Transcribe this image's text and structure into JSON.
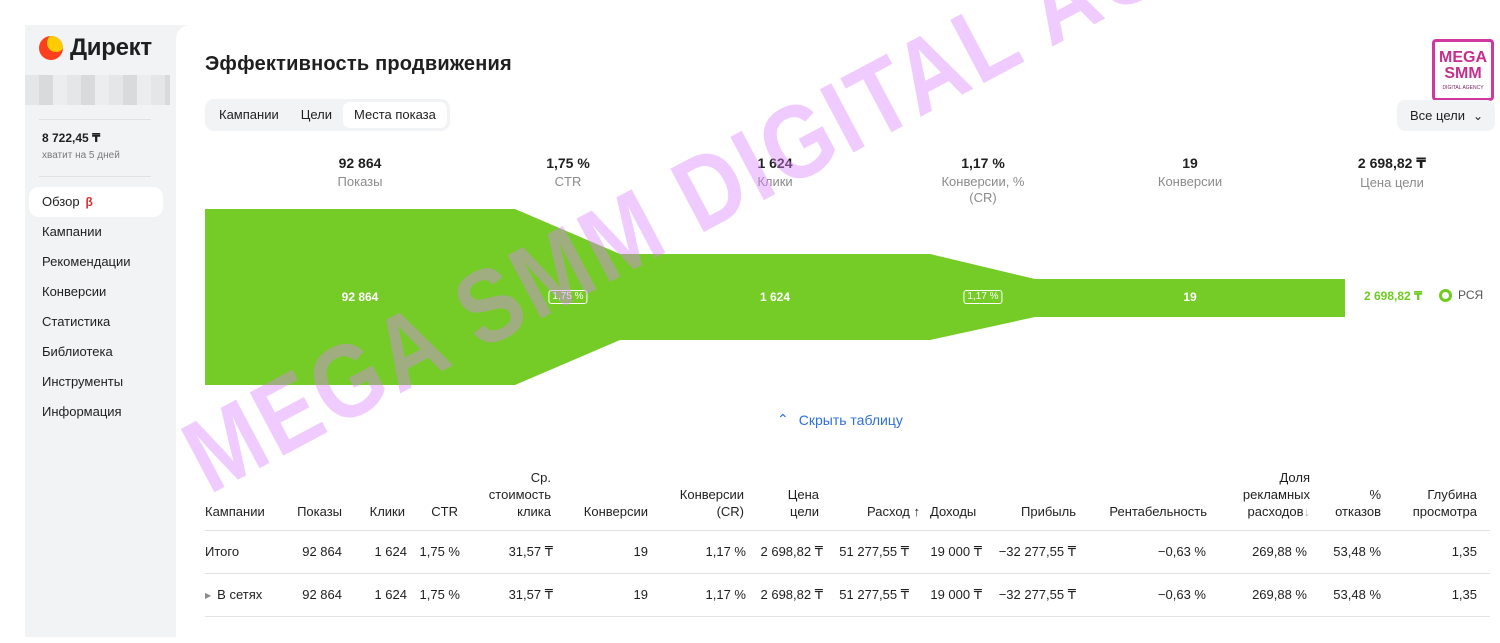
{
  "sidebar": {
    "logo_text": "Директ",
    "balance": "8 722,45 ₸",
    "balance_note": "хватит на 5 дней",
    "items": [
      {
        "label": "Обзор",
        "badge": "β"
      },
      {
        "label": "Кампании"
      },
      {
        "label": "Рекомендации"
      },
      {
        "label": "Конверсии"
      },
      {
        "label": "Статистика"
      },
      {
        "label": "Библиотека"
      },
      {
        "label": "Инструменты"
      },
      {
        "label": "Информация"
      }
    ]
  },
  "header": {
    "title": "Эффективность продвижения",
    "tabs": [
      "Кампании",
      "Цели",
      "Места показа"
    ],
    "goal_select": "Все цели"
  },
  "brand": {
    "line1": "MEGA",
    "line2": "SMM",
    "line3": "DIGITAL AGENCY"
  },
  "metrics": [
    {
      "value": "92 864",
      "label": "Показы"
    },
    {
      "value": "1,75 %",
      "label": "CTR"
    },
    {
      "value": "1 624",
      "label": "Клики"
    },
    {
      "value": "1,17 %",
      "label": "Конверсии, % (CR)"
    },
    {
      "value": "19",
      "label": "Конверсии"
    },
    {
      "value": "2 698,82 ₸",
      "label": "Цена цели"
    }
  ],
  "funnel": {
    "stage1": "92 864",
    "ctr": "1,75 %",
    "stage2": "1 624",
    "cr": "1,17 %",
    "stage3": "19",
    "end_value": "2 698,82 ₸",
    "legend": "РСЯ",
    "color": "#76cc26"
  },
  "hide_table": "Скрыть таблицу",
  "table": {
    "headers": {
      "campaigns": "Кампании",
      "impressions": "Показы",
      "clicks": "Клики",
      "ctr": "CTR",
      "cpc_1": "Ср.",
      "cpc_2": "стоимость",
      "cpc_3": "клика",
      "conversions": "Конверсии",
      "cr_1": "Конверсии",
      "cr_2": "(CR)",
      "goal_cost_1": "Цена",
      "goal_cost_2": "цели",
      "spend": "Расход",
      "spend_sort": "↑",
      "revenue": "Доходы",
      "profit": "Прибыль",
      "profitability": "Рентабельность",
      "ad_share_1": "Доля",
      "ad_share_2": "рекламных",
      "ad_share_3": "расходов",
      "ad_share_sort": "↓",
      "bounce_1": "%",
      "bounce_2": "отказов",
      "depth_1": "Глубина",
      "depth_2": "просмотра"
    },
    "rows": [
      {
        "name": "Итого",
        "impressions": "92 864",
        "clicks": "1 624",
        "ctr": "1,75 %",
        "cpc": "31,57 ₸",
        "conversions": "19",
        "cr": "1,17 %",
        "goal_cost": "2 698,82 ₸",
        "spend": "51 277,55 ₸",
        "revenue": "19 000 ₸",
        "profit": "−32 277,55 ₸",
        "profitability": "−0,63 %",
        "ad_share": "269,88 %",
        "bounce": "53,48 %",
        "depth": "1,35"
      },
      {
        "name": "В сетях",
        "impressions": "92 864",
        "clicks": "1 624",
        "ctr": "1,75 %",
        "cpc": "31,57 ₸",
        "conversions": "19",
        "cr": "1,17 %",
        "goal_cost": "2 698,82 ₸",
        "spend": "51 277,55 ₸",
        "revenue": "19 000 ₸",
        "profit": "−32 277,55 ₸",
        "profitability": "−0,63 %",
        "ad_share": "269,88 %",
        "bounce": "53,48 %",
        "depth": "1,35"
      }
    ]
  },
  "watermark": "MEGA SMM DIGITAL AGENCY"
}
